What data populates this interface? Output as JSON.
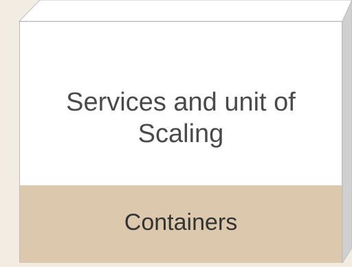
{
  "diagram": {
    "top_label": "Services and unit of Scaling",
    "bottom_label": "Containers",
    "colors": {
      "page_background": "#f3ece2",
      "top_face": "#ffffff",
      "side_face": "#d0d0d0",
      "bottom_band": "#dcc9ad",
      "outline": "#bdbdbd",
      "text": "#4a4a4a"
    }
  }
}
